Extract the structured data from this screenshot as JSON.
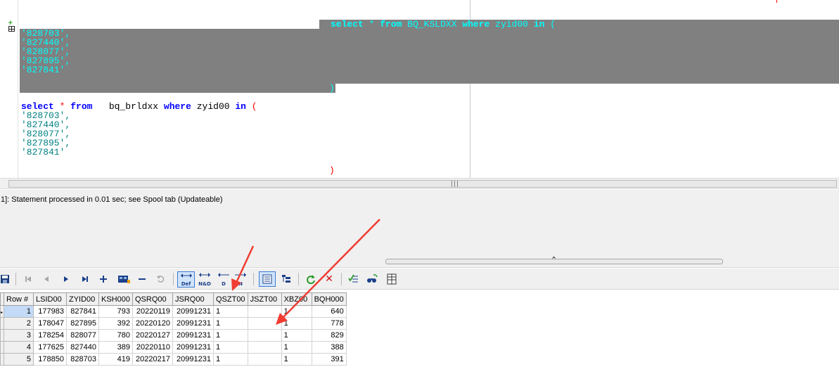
{
  "editor": {
    "block1": {
      "line1": [
        "select",
        "*",
        "from",
        "BQ_KSLDXX",
        "where",
        "zyid00",
        "in",
        "("
      ],
      "values": [
        "'828703',",
        "'827440',",
        "'828077',",
        "'827895',",
        "'827841'"
      ],
      "close": ")"
    },
    "block2": {
      "select": "select",
      "star": "*",
      "from": "from",
      "table": "bq_brldxx",
      "where": "where",
      "col": "zyid00",
      "in": "in",
      "open": "(",
      "values": [
        "'828703',",
        "'827440',",
        "'828077',",
        "'827895',",
        "'827841'"
      ],
      "close": ")"
    }
  },
  "status": {
    "message": "1]: Statement processed in 0.01 sec; see Spool tab (Updateable)"
  },
  "toolbar": {
    "def_label": "Def",
    "nd_label": "N&D",
    "d_label": "D",
    "n_label": "N"
  },
  "grid": {
    "columns": [
      "Row #",
      "LSID00",
      "ZYID00",
      "KSH000",
      "QSRQ00",
      "JSRQ00",
      "QSZT00",
      "JSZT00",
      "XBZ00",
      "BQH000"
    ],
    "rows": [
      [
        "1",
        "177983",
        "827841",
        "793",
        "20220119",
        "20991231",
        "1",
        "",
        "1",
        "640"
      ],
      [
        "2",
        "178047",
        "827895",
        "392",
        "20220120",
        "20991231",
        "1",
        "",
        "1",
        "778"
      ],
      [
        "3",
        "178254",
        "828077",
        "780",
        "20220127",
        "20991231",
        "1",
        "",
        "1",
        "829"
      ],
      [
        "4",
        "177625",
        "827440",
        "389",
        "20220110",
        "20991231",
        "1",
        "",
        "1",
        "388"
      ],
      [
        "5",
        "178850",
        "828703",
        "419",
        "20220217",
        "20991231",
        "1",
        "",
        "1",
        "391"
      ]
    ]
  },
  "colors": {
    "keyword": "#0000ff",
    "operator": "#ff0000",
    "string": "#008080",
    "selection_bg": "#808080",
    "selection_text": "#00ffff",
    "arrow": "#f03c32"
  }
}
